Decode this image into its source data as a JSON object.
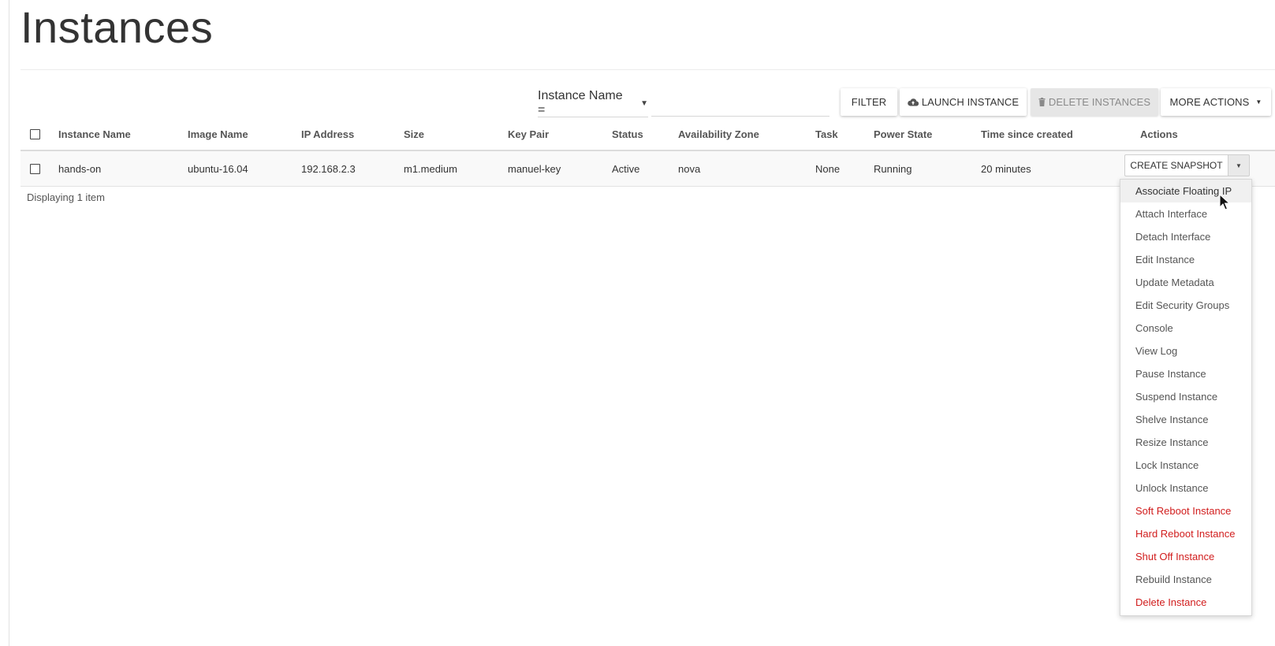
{
  "page": {
    "title": "Instances"
  },
  "toolbar": {
    "filter_field": "Instance Name =",
    "filter_value": "",
    "filter_button": "FILTER",
    "launch_button": "LAUNCH INSTANCE",
    "delete_button": "DELETE INSTANCES",
    "more_button": "MORE ACTIONS"
  },
  "table": {
    "headers": {
      "name": "Instance Name",
      "image": "Image Name",
      "ip": "IP Address",
      "size": "Size",
      "keypair": "Key Pair",
      "status": "Status",
      "zone": "Availability Zone",
      "task": "Task",
      "power": "Power State",
      "time": "Time since created",
      "actions": "Actions"
    },
    "rows": [
      {
        "name": "hands-on",
        "image": "ubuntu-16.04",
        "ip": "192.168.2.3",
        "size": "m1.medium",
        "keypair": "manuel-key",
        "status": "Active",
        "zone": "nova",
        "task": "None",
        "power": "Running",
        "time": "20 minutes",
        "action_label": "CREATE SNAPSHOT"
      }
    ],
    "footer": "Displaying 1 item"
  },
  "menu": {
    "items": [
      {
        "label": "Associate Floating IP",
        "danger": false,
        "hover": true
      },
      {
        "label": "Attach Interface",
        "danger": false
      },
      {
        "label": "Detach Interface",
        "danger": false
      },
      {
        "label": "Edit Instance",
        "danger": false
      },
      {
        "label": "Update Metadata",
        "danger": false
      },
      {
        "label": "Edit Security Groups",
        "danger": false
      },
      {
        "label": "Console",
        "danger": false
      },
      {
        "label": "View Log",
        "danger": false
      },
      {
        "label": "Pause Instance",
        "danger": false
      },
      {
        "label": "Suspend Instance",
        "danger": false
      },
      {
        "label": "Shelve Instance",
        "danger": false
      },
      {
        "label": "Resize Instance",
        "danger": false
      },
      {
        "label": "Lock Instance",
        "danger": false
      },
      {
        "label": "Unlock Instance",
        "danger": false
      },
      {
        "label": "Soft Reboot Instance",
        "danger": true
      },
      {
        "label": "Hard Reboot Instance",
        "danger": true
      },
      {
        "label": "Shut Off Instance",
        "danger": true
      },
      {
        "label": "Rebuild Instance",
        "danger": false
      },
      {
        "label": "Delete Instance",
        "danger": true
      }
    ]
  },
  "colors": {
    "danger": "#d11d1d",
    "text": "#333333",
    "muted": "#555555"
  },
  "icons": {
    "launch": "cloud-upload-icon",
    "delete": "trash-icon",
    "caret": "caret-down-icon"
  }
}
